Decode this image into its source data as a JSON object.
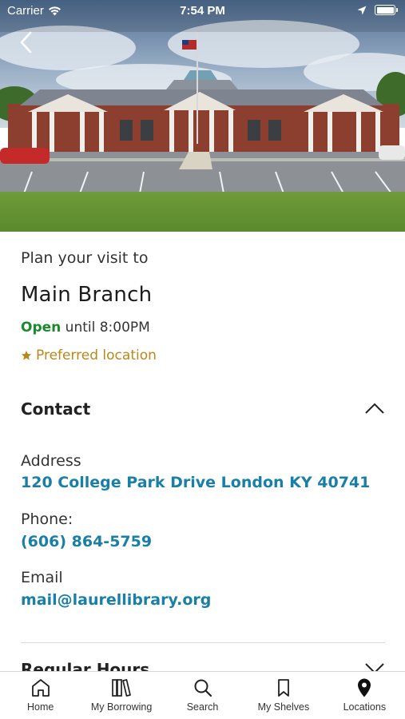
{
  "status_bar": {
    "carrier": "Carrier",
    "time": "7:54 PM"
  },
  "hero": {
    "back_icon": "chevron-left-icon"
  },
  "location": {
    "plan_text": "Plan your visit to",
    "name": "Main Branch",
    "open_status": "Open",
    "open_until": "until 8:00PM",
    "preferred_label": "Preferred location",
    "preferred_icon": "star-icon"
  },
  "contact": {
    "title": "Contact",
    "address_label": "Address",
    "address_value": "120 College Park Drive London KY 40741",
    "phone_label": "Phone:",
    "phone_value": "(606) 864-5759",
    "email_label": "Email",
    "email_value": "mail@laurellibrary.org"
  },
  "regular_hours": {
    "title": "Regular Hours"
  },
  "colors": {
    "open_green": "#1a8a2a",
    "preferred_gold": "#b9871a",
    "link_blue": "#1a7fa6"
  },
  "tabbar": {
    "items": [
      {
        "label": "Home",
        "icon": "home-icon"
      },
      {
        "label": "My Borrowing",
        "icon": "books-icon"
      },
      {
        "label": "Search",
        "icon": "search-icon"
      },
      {
        "label": "My Shelves",
        "icon": "bookmark-icon"
      },
      {
        "label": "Locations",
        "icon": "map-pin-icon"
      }
    ]
  }
}
